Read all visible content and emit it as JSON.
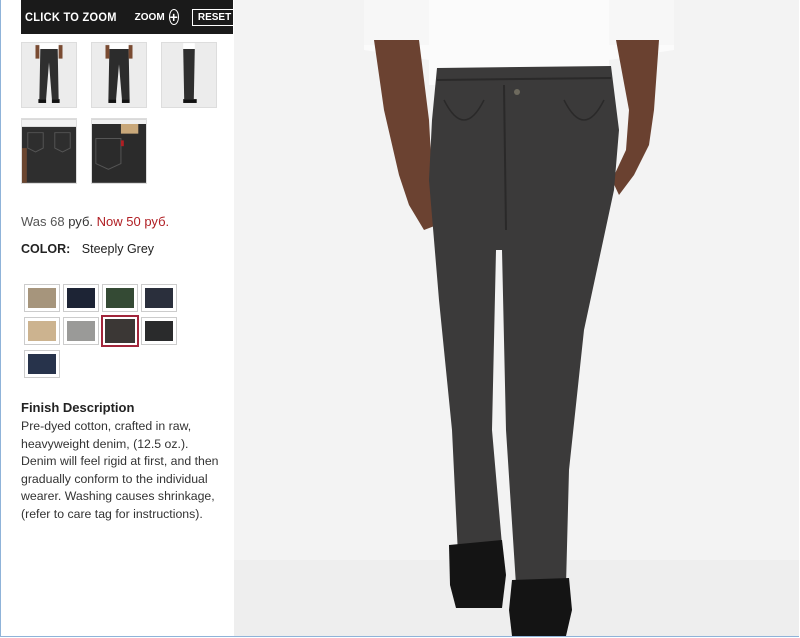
{
  "zoom_bar": {
    "click_to_zoom": "CLICK TO ZOOM",
    "zoom_label": "ZOOM",
    "zoom_icon": "plus-circle-icon",
    "reset_label": "RESET"
  },
  "thumbnails": [
    {
      "view": "front-full"
    },
    {
      "view": "back-full"
    },
    {
      "view": "side-full"
    },
    {
      "view": "back-detail"
    },
    {
      "view": "pocket-detail"
    }
  ],
  "price": {
    "was_label": "Was 68",
    "was_currency": "руб.",
    "now_label": "Now 50",
    "now_currency": "руб."
  },
  "color": {
    "label": "COLOR:",
    "value": "Steeply Grey"
  },
  "swatches": [
    {
      "color": "#a6957c",
      "selected": false
    },
    {
      "color": "#1d2435",
      "selected": false
    },
    {
      "color": "#344a34",
      "selected": false
    },
    {
      "color": "#2a2f3c",
      "selected": false
    },
    {
      "color": "#ccb38f",
      "selected": false
    },
    {
      "color": "#9a9a98",
      "selected": false
    },
    {
      "color": "#3b3735",
      "selected": true
    },
    {
      "color": "#2a2b2c",
      "selected": false
    },
    {
      "color": "#27334b",
      "selected": false
    }
  ],
  "finish": {
    "title": "Finish Description",
    "text": "Pre-dyed cotton, crafted in raw, heavyweight denim, (12.5 oz.). Denim will feel rigid at first, and then gradually conform to the individual wearer. Washing causes shrinkage, (refer to care tag for instructions)."
  },
  "colors": {
    "accent_red": "#b01e23",
    "selected_border": "#a2263b",
    "zoom_bar_bg": "#1a1a1a",
    "jeans": "#3b3a3a"
  }
}
